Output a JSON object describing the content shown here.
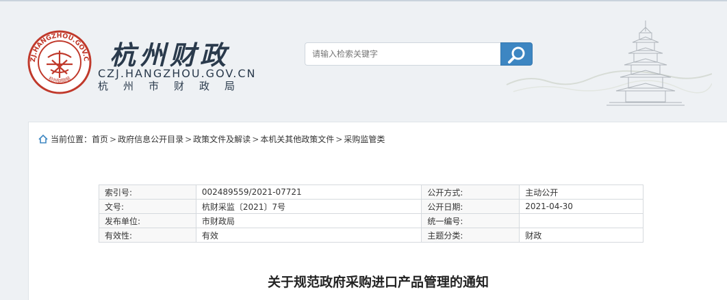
{
  "header": {
    "seal_text": "CZJ.HANGZHOU.GOV.CN",
    "seal_bottom_text": "杭州财政局",
    "title": "杭州财政",
    "domain": "CZJ.HANGZHOU.GOV.CN",
    "subtitle": "杭州市财政局",
    "search_placeholder": "请输入检索关键字",
    "brand_color": "#c0392b",
    "accent_color": "#3d86c2"
  },
  "breadcrumb": {
    "prefix": "当前位置：",
    "items": [
      "首页",
      "政府信息公开目录",
      "政策文件及解读",
      "本机关其他政策文件",
      "采购监管类"
    ],
    "separator": ">"
  },
  "meta": {
    "rows": [
      {
        "k1": "索引号:",
        "v1": "002489559/2021-07721",
        "k2": "公开方式:",
        "v2": "主动公开"
      },
      {
        "k1": "文号:",
        "v1": "杭财采监〔2021〕7号",
        "k2": "公开日期:",
        "v2": "2021-04-30"
      },
      {
        "k1": "发布单位:",
        "v1": "市财政局",
        "k2": "统一编号:",
        "v2": ""
      },
      {
        "k1": "有效性:",
        "v1": "有效",
        "k2": "主题分类:",
        "v2": "财政"
      }
    ]
  },
  "document": {
    "title": "关于规范政府采购进口产品管理的通知"
  }
}
